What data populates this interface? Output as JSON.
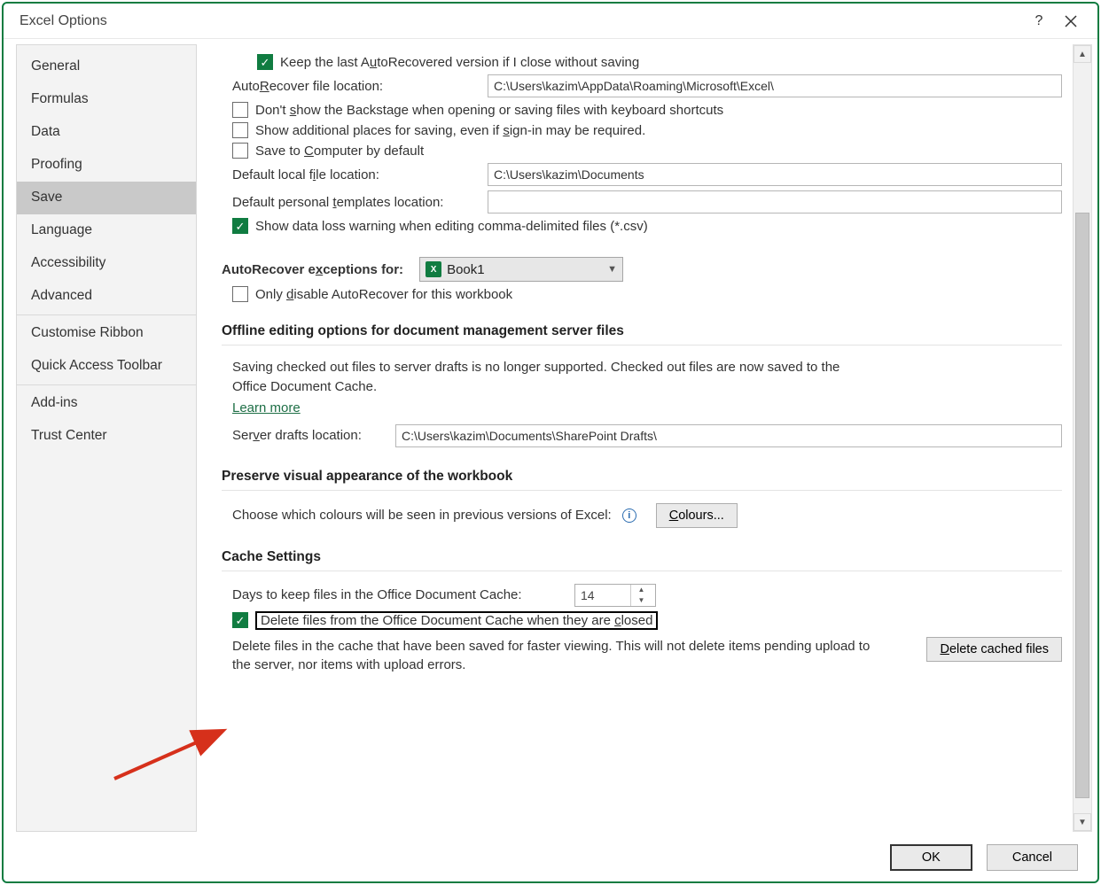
{
  "window": {
    "title": "Excel Options"
  },
  "sidebar": {
    "items": [
      "General",
      "Formulas",
      "Data",
      "Proofing",
      "Save",
      "Language",
      "Accessibility",
      "Advanced",
      "Customise Ribbon",
      "Quick Access Toolbar",
      "Add-ins",
      "Trust Center"
    ],
    "selected": "Save"
  },
  "save": {
    "keep_last_autorecovered": "Keep the last AutoRecovered version if I close without saving",
    "autorecover_loc_label": "AutoRecover file location:",
    "autorecover_loc_value": "C:\\Users\\kazim\\AppData\\Roaming\\Microsoft\\Excel\\",
    "dont_show_backstage": "Don't show the Backstage when opening or saving files with keyboard shortcuts",
    "show_additional_places": "Show additional places for saving, even if sign-in may be required.",
    "save_to_computer": "Save to Computer by default",
    "default_local_loc_label": "Default local file location:",
    "default_local_loc_value": "C:\\Users\\kazim\\Documents",
    "default_templates_label": "Default personal templates location:",
    "default_templates_value": "",
    "show_data_loss": "Show data loss warning when editing comma-delimited files (*.csv)",
    "autorecover_exceptions_label": "AutoRecover exceptions for:",
    "workbook_name": "Book1",
    "only_disable": "Only disable AutoRecover for this workbook"
  },
  "offline": {
    "title": "Offline editing options for document management server files",
    "note": "Saving checked out files to server drafts is no longer supported. Checked out files are now saved to the Office Document Cache.",
    "learn_more": "Learn more",
    "server_drafts_label": "Server drafts location:",
    "server_drafts_value": "C:\\Users\\kazim\\Documents\\SharePoint Drafts\\"
  },
  "preserve": {
    "title": "Preserve visual appearance of the workbook",
    "choose_colours": "Choose which colours will be seen in previous versions of Excel:",
    "colours_btn": "Colours..."
  },
  "cache": {
    "title": "Cache Settings",
    "days_label": "Days to keep files in the Office Document Cache:",
    "days_value": "14",
    "delete_closed": "Delete files from the Office Document Cache when they are closed",
    "delete_desc": "Delete files in the cache that have been saved for faster viewing. This will not delete items pending upload to the server, nor items with upload errors.",
    "delete_btn": "Delete cached files"
  },
  "footer": {
    "ok": "OK",
    "cancel": "Cancel"
  }
}
